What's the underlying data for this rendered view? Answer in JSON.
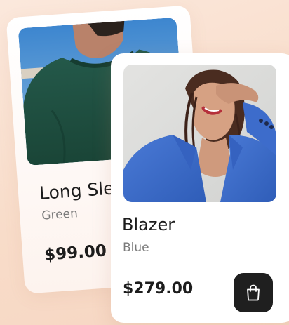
{
  "products": [
    {
      "name": "Long Sleeve",
      "color_label": "Green",
      "price": "$99.00",
      "image_icon": "man-green-sweater-photo",
      "sweater_color": "#1f5142"
    },
    {
      "name": "Blazer",
      "color_label": "Blue",
      "price": "$279.00",
      "image_icon": "woman-blue-blazer-photo",
      "blazer_color": "#3f6fcf"
    }
  ],
  "cart_button": {
    "icon": "shopping-bag-icon"
  }
}
